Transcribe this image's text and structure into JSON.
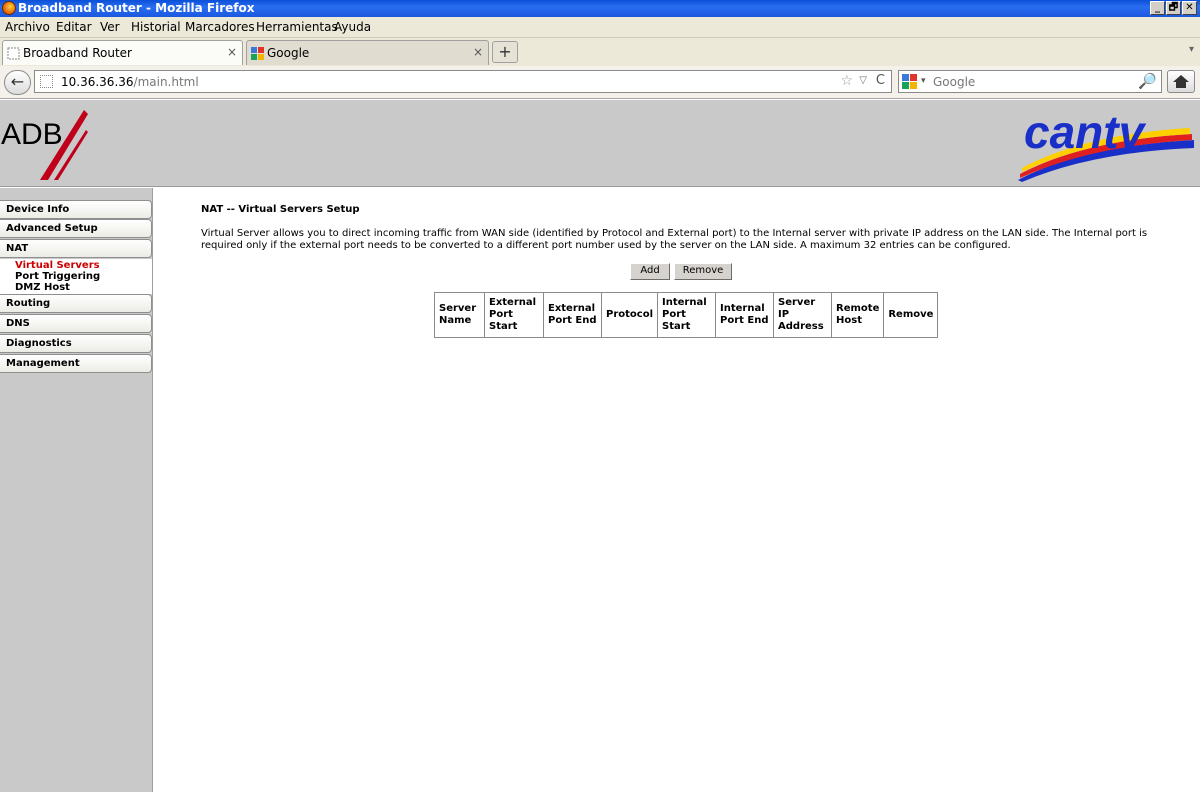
{
  "window": {
    "title": "Broadband Router - Mozilla Firefox",
    "min_label": "_",
    "max_label": "🗗",
    "close_label": "✕"
  },
  "menu": {
    "items": [
      "Archivo",
      "Editar",
      "Ver",
      "Historial",
      "Marcadores",
      "Herramientas",
      "Ayuda"
    ]
  },
  "tabs": [
    {
      "label": "Broadband Router",
      "close": "×",
      "active": true
    },
    {
      "label": "Google",
      "close": "×",
      "active": false
    }
  ],
  "newtab_label": "+",
  "tabscroll_label": "▾",
  "nav": {
    "back_label": "←",
    "url_host": "10.36.36.36",
    "url_path": "/main.html",
    "star": "☆",
    "drop": "▽",
    "reload": "C",
    "search_placeholder": "Google",
    "search_drop": "▾",
    "search_glass": "🔎"
  },
  "header": {
    "left_logo_text": "ADB",
    "right_logo_text": "cantv"
  },
  "sidebar": {
    "items": [
      {
        "label": "Device Info"
      },
      {
        "label": "Advanced Setup"
      },
      {
        "label": "NAT"
      },
      {
        "label": "Routing"
      },
      {
        "label": "DNS"
      },
      {
        "label": "Diagnostics"
      },
      {
        "label": "Management"
      }
    ],
    "nat_subitems": [
      {
        "label": "Virtual Servers",
        "active": true
      },
      {
        "label": "Port Triggering",
        "active": false
      },
      {
        "label": "DMZ Host",
        "active": false
      }
    ]
  },
  "main": {
    "title": "NAT -- Virtual Servers Setup",
    "description": "Virtual Server allows you to direct incoming traffic from WAN side (identified by Protocol and External port) to the Internal server with private IP address on the LAN side. The Internal port is required only if the external port needs to be converted to a different port number used by the server on the LAN side. A maximum 32 entries can be configured.",
    "add_label": "Add",
    "remove_label": "Remove",
    "table_headers": [
      "Server Name",
      "External Port Start",
      "External Port End",
      "Protocol",
      "Internal Port Start",
      "Internal Port End",
      "Server IP Address",
      "Remote Host",
      "Remove"
    ]
  },
  "colors": {
    "active_subitem": "#cc0000",
    "header_bg": "#c9c9c9",
    "cantv_blue": "#1a2fc8",
    "adb_red": "#c0001a"
  }
}
